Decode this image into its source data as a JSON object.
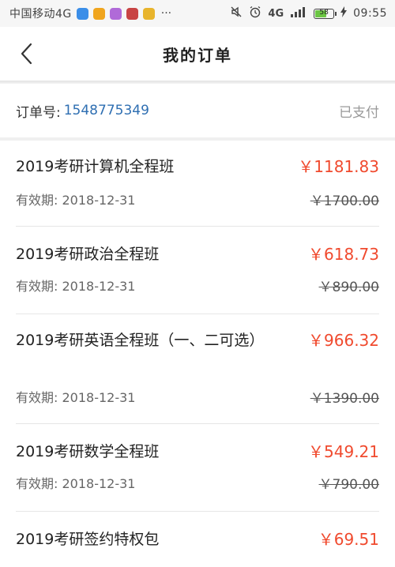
{
  "status_bar": {
    "carrier": "中国移动4G",
    "more": "···",
    "network": "4G",
    "battery_level": "58",
    "time": "09:55"
  },
  "nav": {
    "title": "我的订单",
    "back_icon": "chevron-left-icon"
  },
  "order": {
    "label": "订单号:",
    "number": "1548775349",
    "status": "已支付"
  },
  "items": [
    {
      "name": "2019考研计算机全程班",
      "price": "￥1181.83",
      "valid_label": "有效期:",
      "valid_date": "2018-12-31",
      "original_price": "￥1700.00"
    },
    {
      "name": "2019考研政治全程班",
      "price": "￥618.73",
      "valid_label": "有效期:",
      "valid_date": "2018-12-31",
      "original_price": "￥890.00"
    },
    {
      "name": "2019考研英语全程班（一、二可选）",
      "price": "￥966.32",
      "valid_label": "有效期:",
      "valid_date": "2018-12-31",
      "original_price": "￥1390.00"
    },
    {
      "name": "2019考研数学全程班",
      "price": "￥549.21",
      "valid_label": "有效期:",
      "valid_date": "2018-12-31",
      "original_price": "￥790.00"
    },
    {
      "name": "2019考研签约特权包",
      "price": "￥69.51"
    }
  ],
  "colors": {
    "price": "#f04a2e",
    "order_number": "#2f6fb2",
    "status_paid": "#999999"
  }
}
